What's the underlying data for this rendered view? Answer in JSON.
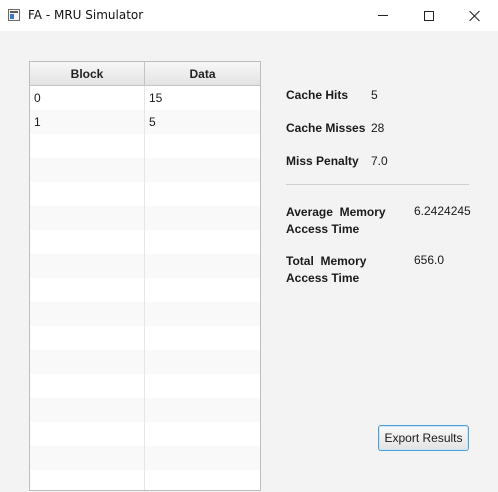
{
  "window": {
    "title": "FA - MRU Simulator"
  },
  "table": {
    "columns": [
      "Block",
      "Data"
    ],
    "rows": [
      [
        "0",
        "15"
      ],
      [
        "1",
        "5"
      ],
      [
        "",
        ""
      ],
      [
        "",
        ""
      ],
      [
        "",
        ""
      ],
      [
        "",
        ""
      ],
      [
        "",
        ""
      ],
      [
        "",
        ""
      ],
      [
        "",
        ""
      ],
      [
        "",
        ""
      ],
      [
        "",
        ""
      ],
      [
        "",
        ""
      ],
      [
        "",
        ""
      ],
      [
        "",
        ""
      ],
      [
        "",
        ""
      ],
      [
        "",
        ""
      ],
      [
        "",
        ""
      ]
    ]
  },
  "stats": {
    "cache_hits_label": "Cache Hits",
    "cache_hits_value": "5",
    "cache_misses_label": "Cache Misses",
    "cache_misses_value": "28",
    "miss_penalty_label": "Miss Penalty",
    "miss_penalty_value": "7.0",
    "avg_access_label_line1": "Average  Memory",
    "avg_access_label_line2": "Access Time",
    "avg_access_value": "6.2424245",
    "total_access_label_line1": "Total  Memory",
    "total_access_label_line2": "Access Time",
    "total_access_value": "656.0"
  },
  "actions": {
    "export_label": "Export Results"
  }
}
